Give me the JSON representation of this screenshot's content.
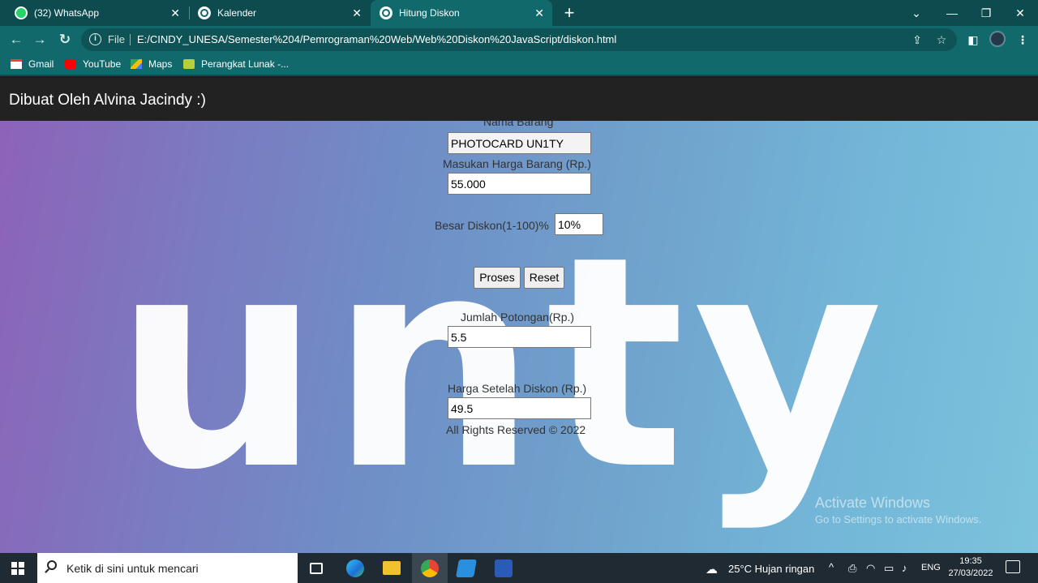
{
  "browser": {
    "tabs": [
      {
        "title": "(32) WhatsApp",
        "icon": "whatsapp-icon",
        "active": false
      },
      {
        "title": "Kalender",
        "icon": "globe-icon",
        "active": false
      },
      {
        "title": "Hitung Diskon",
        "icon": "globe-icon",
        "active": true
      }
    ],
    "new_tab": "+",
    "address": {
      "scheme_label": "File",
      "url": "E:/CINDY_UNESA/Semester%204/Pemrograman%20Web/Web%20Diskon%20JavaScript/diskon.html"
    },
    "bookmarks": [
      {
        "label": "Gmail",
        "icon": "gmail-icon"
      },
      {
        "label": "YouTube",
        "icon": "youtube-icon"
      },
      {
        "label": "Maps",
        "icon": "maps-icon"
      },
      {
        "label": "Perangkat Lunak -...",
        "icon": "folder-app-icon"
      }
    ]
  },
  "page": {
    "header_title": "Dibuat Oleh Alvina Jacindy :)",
    "form": {
      "nama_label": "Nama Barang",
      "nama_value": "PHOTOCARD UN1TY",
      "harga_label": "Masukan Harga Barang (Rp.)",
      "harga_value": "55.000",
      "diskon_label": "Besar Diskon(1-100)%",
      "diskon_value": "10%",
      "proses_button": "Proses",
      "reset_button": "Reset",
      "potongan_label": "Jumlah Potongan(Rp.)",
      "potongan_value": "5.5",
      "harga_akhir_label": "Harga Setelah Diskon (Rp.)",
      "harga_akhir_value": "49.5",
      "footer": "All Rights Reserved © 2022"
    },
    "background_word": "unty",
    "watermark": {
      "line1": "Activate Windows",
      "line2": "Go to Settings to activate Windows."
    }
  },
  "taskbar": {
    "search_placeholder": "Ketik di sini untuk mencari",
    "apps": [
      "task-view-icon",
      "edge-icon",
      "file-explorer-icon",
      "chrome-icon",
      "vscode-icon",
      "word-icon"
    ],
    "weather": "25°C  Hujan ringan",
    "language": "ENG",
    "time": "19:35",
    "date": "27/03/2022"
  },
  "colors": {
    "tabstrip": "#0d4b4f",
    "toolbar": "#12696c",
    "page_header": "#222222",
    "taskbar": "#1f2a33"
  }
}
